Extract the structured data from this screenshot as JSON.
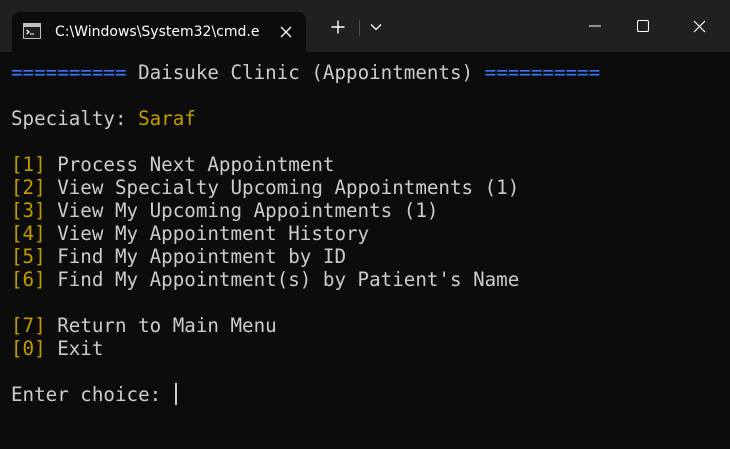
{
  "tab": {
    "title": "C:\\Windows\\System32\\cmd.e",
    "icon": "cmd-icon"
  },
  "tabbar": {
    "new_tab_icon": "plus-icon",
    "dropdown_icon": "chevron-down-icon"
  },
  "window_controls": [
    "minimize-icon",
    "maximize-icon",
    "close-icon"
  ],
  "terminal": {
    "header": {
      "left_rule": "==========",
      "title": " Daisuke Clinic (Appointments) ",
      "right_rule": "=========="
    },
    "specialty": {
      "label": "Specialty: ",
      "value": "Saraf"
    },
    "menu": [
      {
        "key": "[1]",
        "label": " Process Next Appointment"
      },
      {
        "key": "[2]",
        "label": " View Specialty Upcoming Appointments (1)"
      },
      {
        "key": "[3]",
        "label": " View My Upcoming Appointments (1)"
      },
      {
        "key": "[4]",
        "label": " View My Appointment History"
      },
      {
        "key": "[5]",
        "label": " Find My Appointment by ID"
      },
      {
        "key": "[6]",
        "label": " Find My Appointment(s) by Patient's Name"
      },
      {
        "key": "[7]",
        "label": " Return to Main Menu"
      },
      {
        "key": "[0]",
        "label": " Exit"
      }
    ],
    "prompt": "Enter choice: "
  },
  "colors": {
    "background": "#0c0c0c",
    "text": "#cccccc",
    "accent_blue": "#3b78ff",
    "accent_gold": "#c19c00",
    "titlebar": "#202020"
  }
}
